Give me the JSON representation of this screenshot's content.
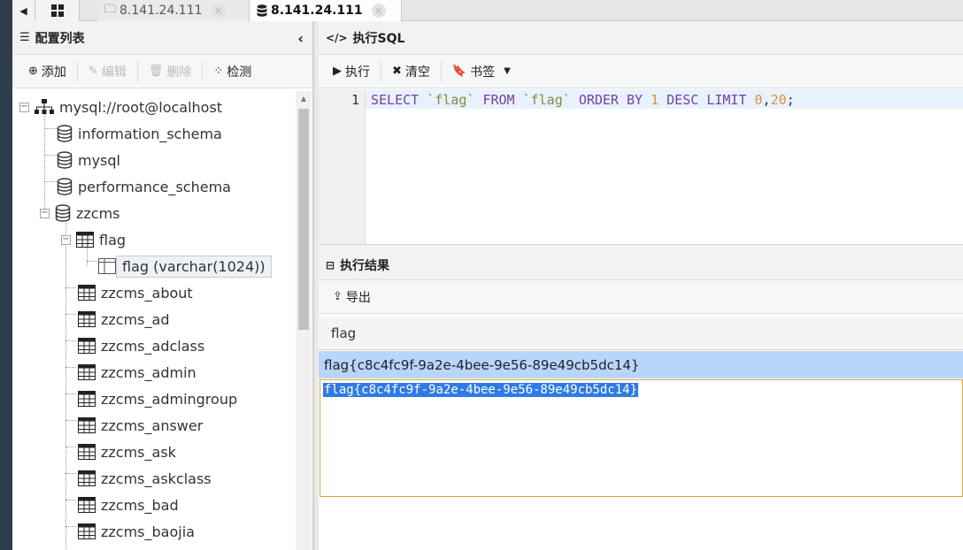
{
  "tabs": {
    "nav_icon": "caret-left-icon",
    "home_icon": "grid-icon",
    "items": [
      {
        "label": "8.141.24.111",
        "icon": "folder-icon",
        "active": false
      },
      {
        "label": "8.141.24.111",
        "icon": "database-icon",
        "active": true
      }
    ]
  },
  "config_panel": {
    "title": "配置列表",
    "toolbar": {
      "add": "添加",
      "edit": "编辑",
      "delete": "删除",
      "check": "检测"
    }
  },
  "tree": {
    "root": "mysql://root@localhost",
    "databases": [
      "information_schema",
      "mysql",
      "performance_schema",
      "zzcms"
    ],
    "table_flag": "flag",
    "column_flag": "flag (varchar(1024))",
    "tables": [
      "zzcms_about",
      "zzcms_ad",
      "zzcms_adclass",
      "zzcms_admin",
      "zzcms_admingroup",
      "zzcms_answer",
      "zzcms_ask",
      "zzcms_askclass",
      "zzcms_bad",
      "zzcms_baojia"
    ]
  },
  "sql_panel": {
    "title": "执行SQL",
    "toolbar": {
      "run": "执行",
      "clear": "清空",
      "bookmark": "书签"
    },
    "line_number": "1",
    "query": "SELECT `flag` FROM `flag` ORDER BY 1 DESC LIMIT 0,20;"
  },
  "result_panel": {
    "title": "执行结果",
    "toolbar": {
      "export": "导出"
    },
    "column": "flag",
    "row_value": "flag{c8c4fc9f-9a2e-4bee-9e56-89e49cb5dc14}",
    "editor_value": "flag{c8c4fc9f-9a2e-4bee-9e56-89e49cb5dc14}"
  }
}
